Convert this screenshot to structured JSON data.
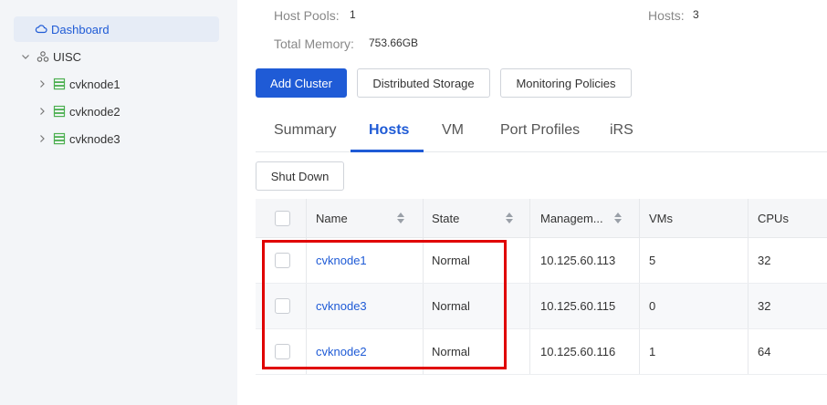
{
  "sidebar": {
    "dashboard": "Dashboard",
    "root": "UISC",
    "nodes": [
      "cvknode1",
      "cvknode2",
      "cvknode3"
    ]
  },
  "summary": {
    "host_pools_label": "Host Pools:",
    "host_pools_value": "1",
    "hosts_label": "Hosts:",
    "hosts_value": "3",
    "total_memory_label": "Total Memory:",
    "total_memory_value": "753.66GB"
  },
  "actions": {
    "add_cluster": "Add Cluster",
    "distributed_storage": "Distributed Storage",
    "monitoring_policies": "Monitoring Policies"
  },
  "tabs": [
    "Summary",
    "Hosts",
    "VM",
    "Port Profiles",
    "iRS"
  ],
  "active_tab": "Hosts",
  "table": {
    "shut_down": "Shut Down",
    "columns": [
      "Name",
      "State",
      "Managem...",
      "VMs",
      "CPUs"
    ],
    "rows": [
      {
        "name": "cvknode1",
        "state": "Normal",
        "mgmt": "10.125.60.113",
        "vms": "5",
        "cpus": "32"
      },
      {
        "name": "cvknode3",
        "state": "Normal",
        "mgmt": "10.125.60.115",
        "vms": "0",
        "cpus": "32"
      },
      {
        "name": "cvknode2",
        "state": "Normal",
        "mgmt": "10.125.60.116",
        "vms": "1",
        "cpus": "64"
      }
    ]
  },
  "colors": {
    "accent": "#1f5bd6",
    "highlight": "#e00000",
    "node_icon": "#4caf50"
  },
  "icons": {
    "dashboard": "cloud-icon",
    "root": "cluster-icon",
    "node": "server-icon",
    "expand": "chevron-right-icon",
    "collapse": "chevron-down-icon",
    "sort": "sort-icon"
  }
}
